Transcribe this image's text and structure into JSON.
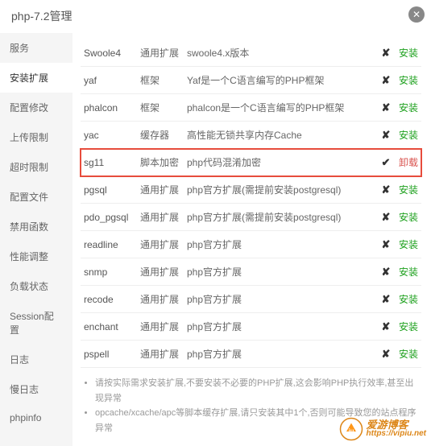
{
  "header": {
    "title": "php-7.2管理"
  },
  "sidebar": {
    "items": [
      {
        "label": "服务"
      },
      {
        "label": "安装扩展"
      },
      {
        "label": "配置修改"
      },
      {
        "label": "上传限制"
      },
      {
        "label": "超时限制"
      },
      {
        "label": "配置文件"
      },
      {
        "label": "禁用函数"
      },
      {
        "label": "性能调整"
      },
      {
        "label": "负载状态"
      },
      {
        "label": "Session配置"
      },
      {
        "label": "日志"
      },
      {
        "label": "慢日志"
      },
      {
        "label": "phpinfo"
      }
    ]
  },
  "ext": {
    "rows": [
      {
        "name": "Swoole4",
        "type": "通用扩展",
        "desc": "swoole4.x版本",
        "installed": false
      },
      {
        "name": "yaf",
        "type": "框架",
        "desc": "Yaf是一个C语言编写的PHP框架",
        "installed": false
      },
      {
        "name": "phalcon",
        "type": "框架",
        "desc": "phalcon是一个C语言编写的PHP框架",
        "installed": false
      },
      {
        "name": "yac",
        "type": "缓存器",
        "desc": "高性能无锁共享内存Cache",
        "installed": false
      },
      {
        "name": "sg11",
        "type": "脚本加密",
        "desc": "php代码混淆加密",
        "installed": true
      },
      {
        "name": "pgsql",
        "type": "通用扩展",
        "desc": "php官方扩展(需提前安装postgresql)",
        "installed": false
      },
      {
        "name": "pdo_pgsql",
        "type": "通用扩展",
        "desc": "php官方扩展(需提前安装postgresql)",
        "installed": false
      },
      {
        "name": "readline",
        "type": "通用扩展",
        "desc": "php官方扩展",
        "installed": false
      },
      {
        "name": "snmp",
        "type": "通用扩展",
        "desc": "php官方扩展",
        "installed": false
      },
      {
        "name": "recode",
        "type": "通用扩展",
        "desc": "php官方扩展",
        "installed": false
      },
      {
        "name": "enchant",
        "type": "通用扩展",
        "desc": "php官方扩展",
        "installed": false
      },
      {
        "name": "pspell",
        "type": "通用扩展",
        "desc": "php官方扩展",
        "installed": false
      }
    ],
    "action_install": "安装",
    "action_uninstall": "卸载",
    "highlight_index": 4
  },
  "notes": {
    "n1": "请按实际需求安装扩展,不要安装不必要的PHP扩展,这会影响PHP执行效率,甚至出现异常",
    "n2": "opcache/xcache/apc等脚本缓存扩展,请只安装其中1个,否则可能导致您的站点程序异常"
  },
  "watermark": {
    "name": "爱游博客",
    "url": "https://vipiu.net"
  }
}
